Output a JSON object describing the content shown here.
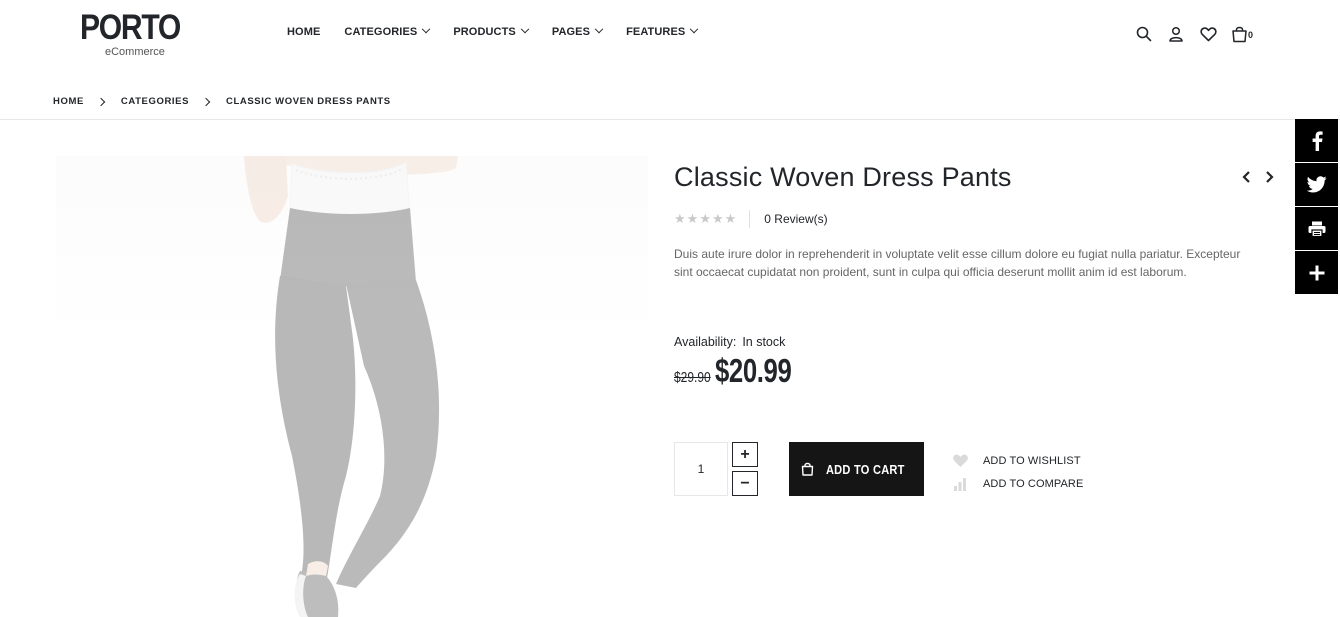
{
  "brand": {
    "name": "PORTO",
    "tagline": "eCommerce"
  },
  "nav": [
    {
      "label": "HOME",
      "has_dropdown": false
    },
    {
      "label": "CATEGORIES",
      "has_dropdown": true
    },
    {
      "label": "PRODUCTS",
      "has_dropdown": true
    },
    {
      "label": "PAGES",
      "has_dropdown": true
    },
    {
      "label": "FEATURES",
      "has_dropdown": true
    }
  ],
  "header_icons": [
    "search-icon",
    "user-icon",
    "heart-icon",
    "cart-icon"
  ],
  "cart": {
    "count": "0"
  },
  "breadcrumb": [
    "HOME",
    "CATEGORIES",
    "CLASSIC WOVEN DRESS PANTS"
  ],
  "product": {
    "title": "Classic Woven Dress Pants",
    "rating_stars": 0,
    "reviews": "0 Review(s)",
    "description": "Duis aute irure dolor in reprehenderit in voluptate velit esse cillum dolore eu fugiat nulla pariatur. Excepteur sint occaecat cupidatat non proident, sunt in culpa qui officia deserunt mollit anim id est laborum.",
    "availability_label": "Availability:",
    "availability_value": "In stock",
    "old_price": "$29.90",
    "new_price": "$20.99",
    "quantity": "1"
  },
  "buttons": {
    "qty_plus": "+",
    "qty_minus": "−",
    "add_to_cart": "ADD TO CART",
    "add_to_wishlist": "ADD TO WISHLIST",
    "add_to_compare": "ADD TO COMPARE"
  },
  "social": [
    "facebook-icon",
    "twitter-icon",
    "print-icon",
    "plus-icon"
  ],
  "colors": {
    "text": "#222529",
    "button_bg": "#151515",
    "muted": "#666666",
    "star": "#c9c9c9"
  }
}
